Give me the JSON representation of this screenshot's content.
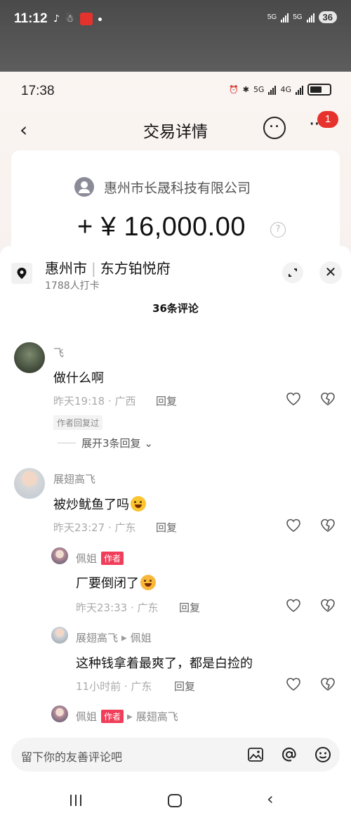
{
  "outer_status": {
    "time": "11:12",
    "signal1": "5G",
    "signal2": "5G",
    "battery": "36"
  },
  "inner_status": {
    "time": "17:38",
    "net1": "5G",
    "net2": "4G"
  },
  "transaction": {
    "title": "交易详情",
    "notification_count": "1",
    "company": "惠州市长晟科技有限公司",
    "amount": "+ ¥ 16,000.00",
    "help": "?"
  },
  "sheet": {
    "location_city": "惠州市",
    "location_place": "东方铂悦府",
    "checkins": "1788人打卡",
    "title": "36条评论"
  },
  "comments": [
    {
      "name": "飞",
      "text": "做什么啊",
      "meta": "昨天19:18 · 广西",
      "reply": "回复",
      "badge": "作者回复过",
      "expand": "展开3条回复"
    },
    {
      "name": "展翅高飞",
      "text": "被炒鱿鱼了吗",
      "meta": "昨天23:27 · 广东",
      "reply": "回复"
    }
  ],
  "replies": [
    {
      "name": "佩姐",
      "author_tag": "作者",
      "text": "厂要倒闭了",
      "meta": "昨天23:33 · 广东",
      "reply": "回复"
    },
    {
      "name": "展翅高飞",
      "reply_to": "佩姐",
      "text": "这种钱拿着最爽了，都是白捡的",
      "meta": "11小时前 · 广东",
      "reply": "回复"
    },
    {
      "name": "佩姐",
      "author_tag": "作者",
      "reply_to": "展翅高飞"
    }
  ],
  "input": {
    "placeholder": "留下你的友善评论吧"
  }
}
